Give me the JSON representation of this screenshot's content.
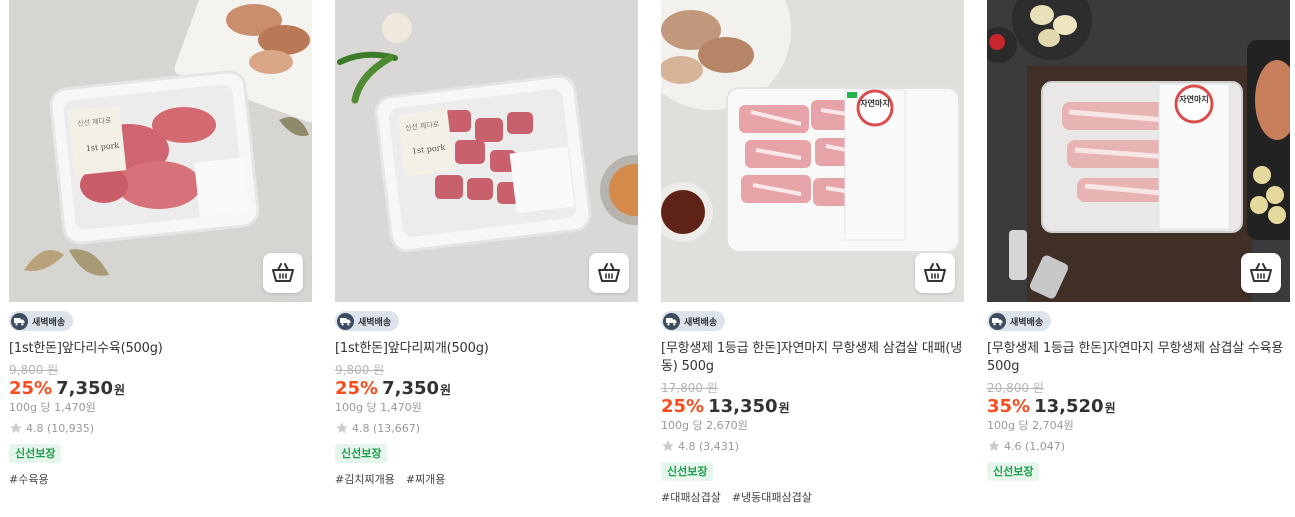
{
  "colors": {
    "discount": "#fa4d1f",
    "badge_text": "#1c9f4a",
    "badge_bg": "#e7f6ec"
  },
  "products": [
    {
      "delivery": "새벽배송",
      "title": "[1st한돈]앞다리수육(500g)",
      "original_price": "9,800 원",
      "discount": "25%",
      "price": "7,350",
      "won": "원",
      "unit_price": "100g 당 1,470원",
      "rating": "4.8 (10,935)",
      "badge": "신선보장",
      "tags": [
        "#수육용"
      ]
    },
    {
      "delivery": "새벽배송",
      "title": "[1st한돈]앞다리찌개(500g)",
      "original_price": "9,800 원",
      "discount": "25%",
      "price": "7,350",
      "won": "원",
      "unit_price": "100g 당 1,470원",
      "rating": "4.8 (13,667)",
      "badge": "신선보장",
      "tags": [
        "#김치찌개용",
        "#찌개용"
      ]
    },
    {
      "delivery": "새벽배송",
      "title": "[무항생제 1등급 한돈]자연마지 무항생제 삼겹살 대패(냉동) 500g",
      "original_price": "17,800 원",
      "discount": "25%",
      "price": "13,350",
      "won": "원",
      "unit_price": "100g 당 2,670원",
      "rating": "4.8 (3,431)",
      "badge": "신선보장",
      "tags": [
        "#대패삼겹살",
        "#냉동대패삼겹살"
      ]
    },
    {
      "delivery": "새벽배송",
      "title": "[무항생제 1등급 한돈]자연마지 무항생제 삼겹살 수육용 500g",
      "original_price": "20,800 원",
      "discount": "35%",
      "price": "13,520",
      "won": "원",
      "unit_price": "100g 당 2,704원",
      "rating": "4.6 (1,047)",
      "badge": "신선보장",
      "tags": []
    }
  ],
  "images": {
    "p1_label_1": "신선 제다로",
    "p1_label_2": "1st pork",
    "p2_label_1": "신선 제다로",
    "p2_label_2": "1st pork",
    "p3_brand": "자연마지",
    "p4_brand": "자연마지"
  }
}
